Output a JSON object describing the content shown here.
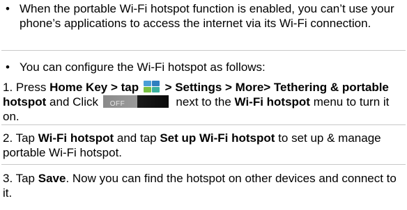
{
  "bullets": [
    {
      "text": "When the portable Wi-Fi hotspot function is enabled, you can’t use your phone’s applications to access the internet via its Wi-Fi connection."
    },
    {
      "text": "You can configure the Wi-Fi hotspot as follows:"
    }
  ],
  "step1": {
    "prefix": "1. Press ",
    "home_key": "Home Key",
    "tap": " > tap ",
    "path": " > Settings > More> Tethering & portable hotspot",
    "click": " and Click ",
    "toggle_label": "OFF",
    "next_to": " next to the ",
    "wifi_hotspot": "Wi-Fi hotspot",
    "suffix": " menu to turn it on."
  },
  "step2": {
    "prefix": "2. Tap ",
    "wifi_hotspot": "Wi-Fi hotspot",
    "and_tap": " and tap ",
    "setup": "Set up Wi-Fi hotspot",
    "suffix": " to set up & manage portable Wi-Fi hotspot."
  },
  "step3": {
    "prefix": "3. Tap ",
    "save": "Save",
    "suffix": ". Now you can find the hotspot on other devices and connect to it."
  }
}
